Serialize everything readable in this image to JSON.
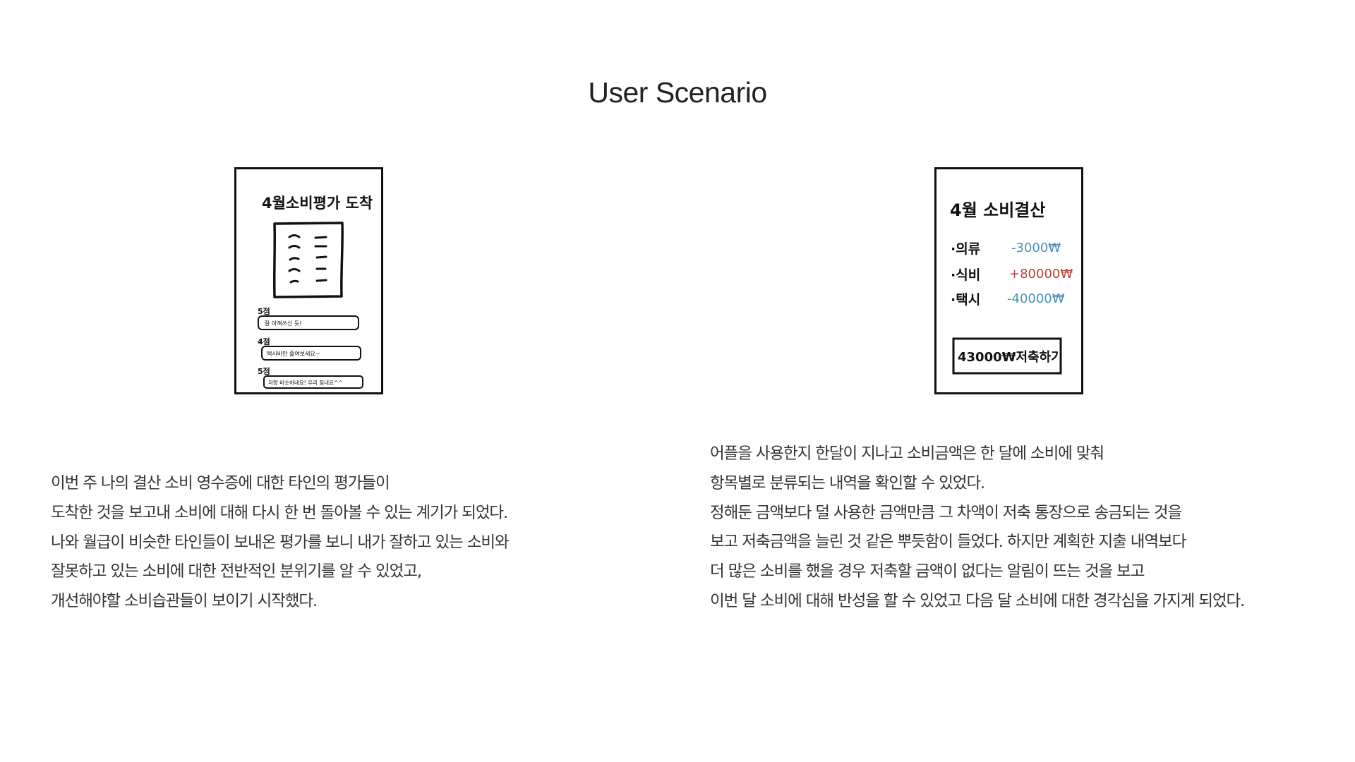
{
  "page": {
    "title": "User Scenario"
  },
  "scenario_left": {
    "sketch": {
      "heading": "4월소비평가 도착",
      "ratings": [
        {
          "score": "5점",
          "comment": "잘 아껴쓰신 듯!"
        },
        {
          "score": "4점",
          "comment": "택시비만 줄여보세요~"
        },
        {
          "score": "5점",
          "comment": "저랑 비슷하네요! 우리 힘내요^^"
        }
      ]
    },
    "lines": [
      "이번 주 나의 결산 소비 영수증에 대한 타인의 평가들이",
      "도착한 것을 보고내 소비에 대해 다시 한 번 돌아볼 수 있는 계기가 되었다.",
      "나와 월급이 비슷한 타인들이 보내온 평가를 보니 내가 잘하고 있는 소비와",
      "잘못하고 있는 소비에 대한 전반적인 분위기를 알 수 있었고,",
      "개선해야할 소비습관들이 보이기 시작했다."
    ]
  },
  "scenario_right": {
    "sketch": {
      "heading": "4월 소비결산",
      "items": [
        {
          "label": "·의류",
          "amount": "-3000₩",
          "color": "#4f8fb5"
        },
        {
          "label": "·식비",
          "amount": "+80000₩",
          "color": "#b5443a"
        },
        {
          "label": "·택시",
          "amount": "-40000₩",
          "color": "#4f8fb5"
        }
      ],
      "button": "43000₩저축하기"
    },
    "lines": [
      "어플을 사용한지 한달이 지나고 소비금액은 한 달에 소비에 맞춰",
      "항목별로 분류되는 내역을 확인할 수 있었다.",
      "정해둔 금액보다 덜 사용한 금액만큼 그 차액이 저축 통장으로 송금되는 것을",
      "보고 저축금액을 늘린 것 같은 뿌듯함이 들었다. 하지만 계획한 지출 내역보다",
      "더 많은 소비를 했을 경우 저축할 금액이 없다는 알림이 뜨는 것을 보고",
      "이번 달 소비에 대해 반성을 할 수 있었고 다음 달 소비에 대한 경각심을 가지게 되었다."
    ]
  }
}
